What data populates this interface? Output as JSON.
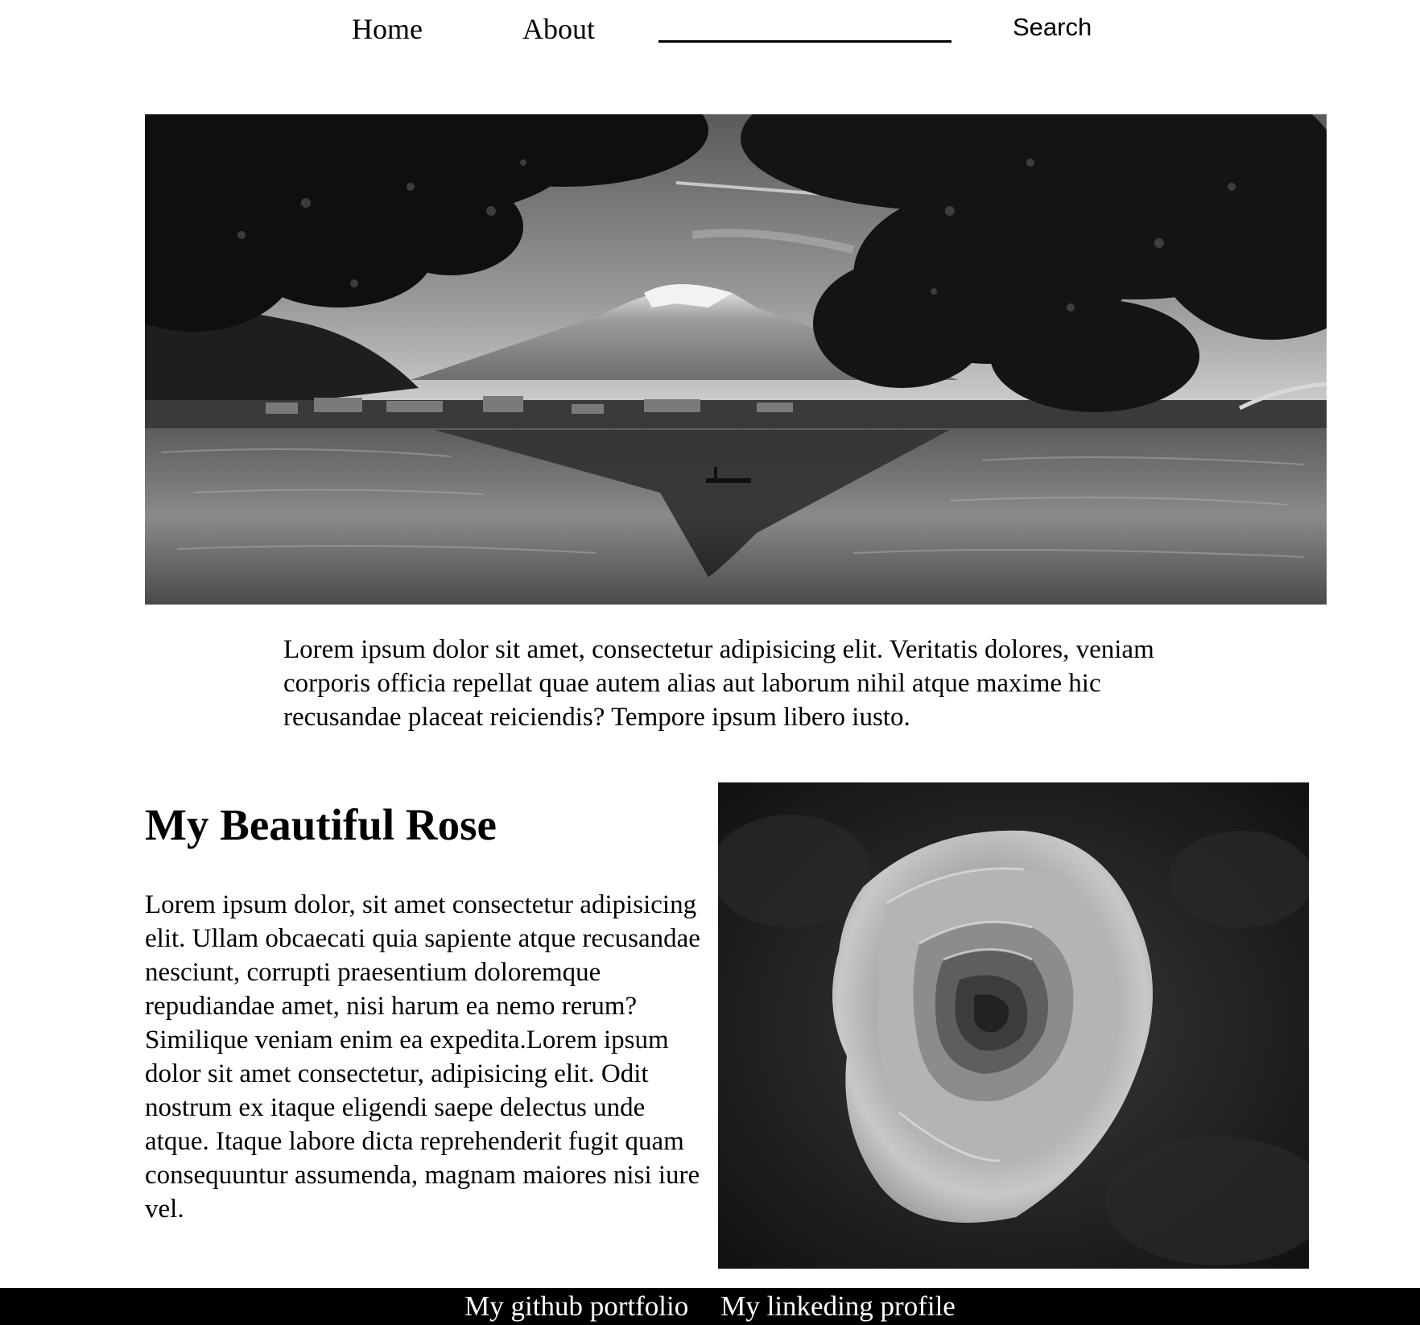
{
  "nav": {
    "home_label": "Home",
    "about_label": "About",
    "search_value": "",
    "search_button_label": "Search"
  },
  "hero": {
    "image_subject": "mountain-lake-landscape"
  },
  "intro": {
    "text": "Lorem ipsum dolor sit amet, consectetur adipisicing elit. Veritatis dolores, veniam corporis officia repellat quae autem alias aut laborum nihil atque maxime hic recusandae placeat reiciendis? Tempore ipsum libero iusto."
  },
  "rose_section": {
    "title": "My Beautiful Rose",
    "text": "Lorem ipsum dolor, sit amet consectetur adipisicing elit. Ullam obcaecati quia sapiente atque recusandae nesciunt, corrupti praesentium doloremque repudiandae amet, nisi harum ea nemo rerum? Similique veniam enim ea expedita.Lorem ipsum dolor sit amet consectetur, adipisicing elit. Odit nostrum ex itaque eligendi saepe delectus unde atque. Itaque labore dicta reprehenderit fugit quam consequuntur assumenda, magnam maiores nisi iure vel.",
    "image_subject": "rose-flower"
  },
  "footer": {
    "github_label": "My github portfolio",
    "linkedin_label": "My linkeding profile"
  },
  "colors": {
    "page_background": "#ffffff",
    "text": "#000000",
    "footer_background": "#000000",
    "footer_text": "#ffffff"
  }
}
